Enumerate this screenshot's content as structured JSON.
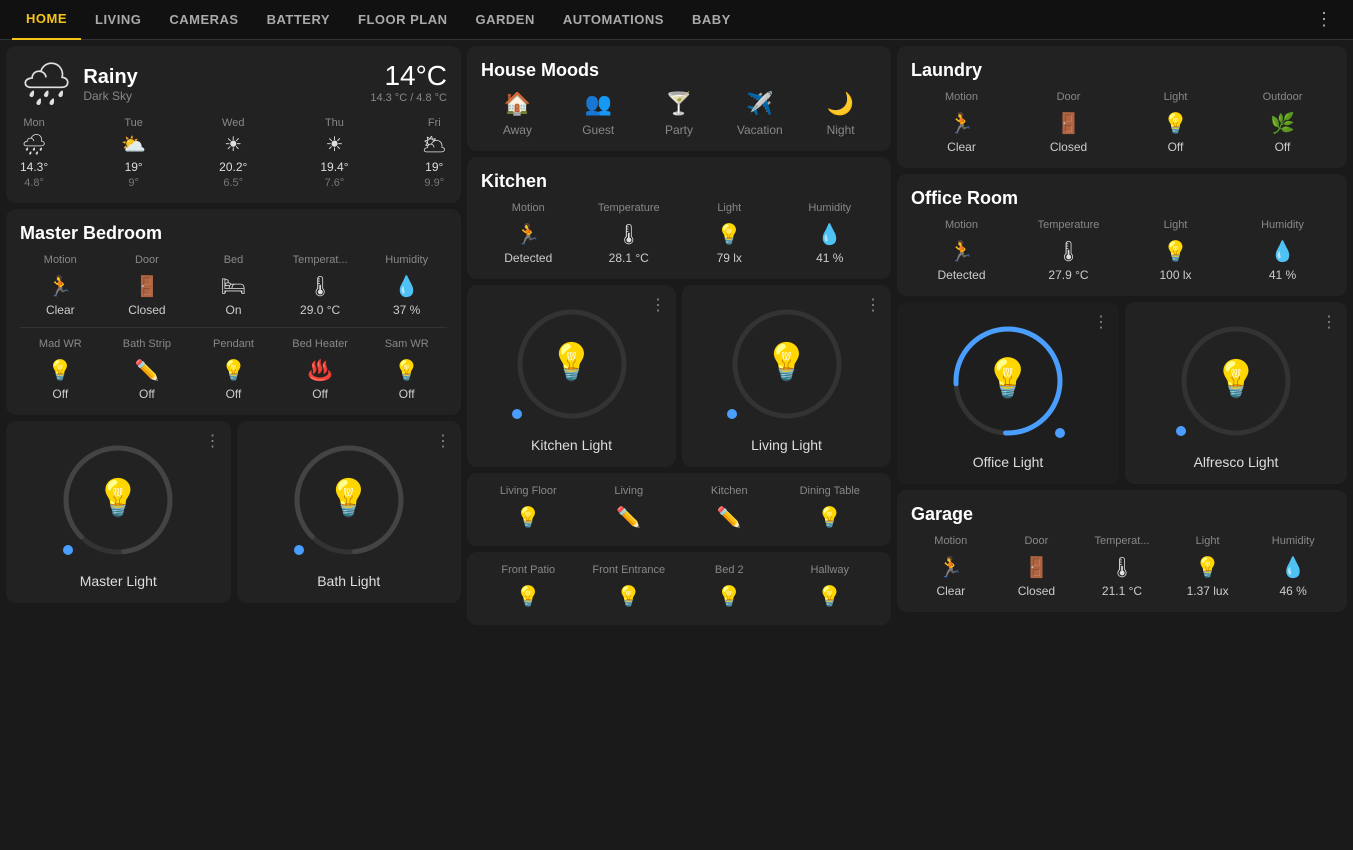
{
  "nav": {
    "items": [
      "HOME",
      "LIVING",
      "CAMERAS",
      "BATTERY",
      "FLOOR PLAN",
      "GARDEN",
      "AUTOMATIONS",
      "BABY"
    ],
    "active": "HOME"
  },
  "weather": {
    "condition": "Rainy",
    "description": "Dark Sky",
    "temp": "14°C",
    "range": "14.3 °C / 4.8 °C",
    "days": [
      {
        "name": "Mon",
        "icon": "🌧",
        "hi": "14.3°",
        "lo": "4.8°"
      },
      {
        "name": "Tue",
        "icon": "⛅",
        "hi": "19°",
        "lo": "9°"
      },
      {
        "name": "Wed",
        "icon": "☀",
        "hi": "20.2°",
        "lo": "6.5°"
      },
      {
        "name": "Thu",
        "icon": "☀",
        "hi": "19.4°",
        "lo": "7.6°"
      },
      {
        "name": "Fri",
        "icon": "🌥",
        "hi": "19°",
        "lo": "9.9°"
      }
    ]
  },
  "master_bedroom": {
    "title": "Master Bedroom",
    "sensors": [
      {
        "label": "Motion",
        "icon": "🏃",
        "value": "Clear"
      },
      {
        "label": "Door",
        "icon": "🚪",
        "value": "Closed"
      },
      {
        "label": "Bed",
        "icon": "🛏",
        "value": "On"
      },
      {
        "label": "Temperat...",
        "icon": "🌡",
        "value": "29.0 °C"
      },
      {
        "label": "Humidity",
        "icon": "💧",
        "value": "37 %"
      }
    ],
    "lights": [
      {
        "label": "Mad WR",
        "icon": "💡",
        "value": "Off"
      },
      {
        "label": "Bath Strip",
        "icon": "✏",
        "value": "Off"
      },
      {
        "label": "Pendant",
        "icon": "💡",
        "value": "Off"
      },
      {
        "label": "Bed Heater",
        "icon": "♨",
        "value": "Off"
      },
      {
        "label": "Sam WR",
        "icon": "💡",
        "value": "Off"
      }
    ]
  },
  "master_light": {
    "title": "Master Light",
    "on": false
  },
  "bath_light": {
    "title": "Bath Light",
    "on": false
  },
  "house_moods": {
    "title": "House Moods",
    "moods": [
      {
        "label": "Away",
        "icon": "🏠"
      },
      {
        "label": "Guest",
        "icon": "👥"
      },
      {
        "label": "Party",
        "icon": "🍸"
      },
      {
        "label": "Vacation",
        "icon": "✈"
      },
      {
        "label": "Night",
        "icon": "🌙"
      }
    ]
  },
  "kitchen": {
    "title": "Kitchen",
    "sensors": [
      {
        "label": "Motion",
        "icon": "🏃",
        "value": "Detected",
        "detected": true
      },
      {
        "label": "Temperature",
        "icon": "🌡",
        "value": "28.1 °C"
      },
      {
        "label": "Light",
        "icon": "💡",
        "value": "79 lx"
      },
      {
        "label": "Humidity",
        "icon": "💧",
        "value": "41 %"
      }
    ]
  },
  "kitchen_light": {
    "title": "Kitchen Light",
    "on": false
  },
  "living_light": {
    "title": "Living Light",
    "on": false
  },
  "strip1": {
    "items": [
      {
        "label": "Living Floor",
        "icon": "💡",
        "value": ""
      },
      {
        "label": "Living",
        "icon": "✏",
        "value": ""
      },
      {
        "label": "Kitchen",
        "icon": "✏",
        "value": ""
      },
      {
        "label": "Dining Table",
        "icon": "💡",
        "value": ""
      }
    ]
  },
  "strip2": {
    "items": [
      {
        "label": "Front Patio",
        "icon": "💡",
        "value": ""
      },
      {
        "label": "Front Entrance",
        "icon": "💡",
        "value": ""
      },
      {
        "label": "Bed 2",
        "icon": "💡",
        "value": ""
      },
      {
        "label": "Hallway",
        "icon": "💡",
        "value": ""
      }
    ]
  },
  "laundry": {
    "title": "Laundry",
    "sensors": [
      {
        "label": "Motion",
        "icon": "🏃",
        "value": "Clear"
      },
      {
        "label": "Door",
        "icon": "🚪",
        "value": "Closed"
      },
      {
        "label": "Light",
        "icon": "💡",
        "value": "Off"
      },
      {
        "label": "Outdoor",
        "icon": "🌿",
        "value": "Off"
      }
    ]
  },
  "office_room": {
    "title": "Office Room",
    "sensors": [
      {
        "label": "Motion",
        "icon": "🏃",
        "value": "Detected",
        "detected": true
      },
      {
        "label": "Temperature",
        "icon": "🌡",
        "value": "27.9 °C"
      },
      {
        "label": "Light",
        "icon": "💡",
        "value": "100 lx"
      },
      {
        "label": "Humidity",
        "icon": "💧",
        "value": "41 %"
      }
    ]
  },
  "office_light": {
    "title": "Office Light",
    "on": true
  },
  "alfresco_light": {
    "title": "Alfresco Light",
    "on": false
  },
  "garage": {
    "title": "Garage",
    "sensors": [
      {
        "label": "Motion",
        "icon": "🏃",
        "value": "Clear"
      },
      {
        "label": "Door",
        "icon": "🚪",
        "value": "Closed"
      },
      {
        "label": "Temperat...",
        "icon": "🌡",
        "value": "21.1 °C"
      },
      {
        "label": "Light",
        "icon": "💡",
        "value": "1.37 lux"
      },
      {
        "label": "Humidity",
        "icon": "💧",
        "value": "46 %"
      }
    ]
  },
  "labels": {
    "three_dots": "⋮"
  }
}
